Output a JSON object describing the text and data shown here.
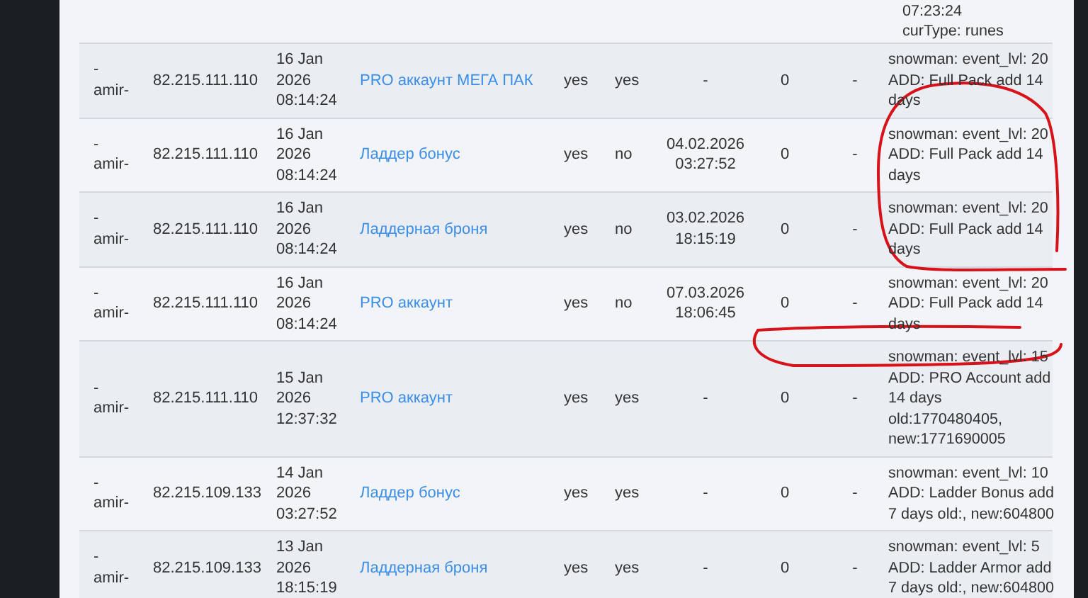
{
  "partial_row": {
    "notes": [
      "07:23:24",
      "curType: runes"
    ]
  },
  "rows": [
    {
      "user": [
        "-",
        "amir-"
      ],
      "ip": "82.215.111.110",
      "date": "16 Jan 2026 08:14:24",
      "item": "PRO аккаунт МЕГА ПАК",
      "column_5": "yes",
      "column_6": "yes",
      "column_7": "-",
      "column_8": "0",
      "column_9": "-",
      "notes": [
        "snowman: event_lvl: 20",
        "ADD: Full Pack add 14",
        "days"
      ]
    },
    {
      "user": [
        "-",
        "amir-"
      ],
      "ip": "82.215.111.110",
      "date": "16 Jan 2026 08:14:24",
      "item": "Ладдер бонус",
      "column_5": "yes",
      "column_6": "no",
      "column_7": "04.02.2026 03:27:52",
      "column_8": "0",
      "column_9": "-",
      "notes": [
        "snowman: event_lvl: 20",
        "ADD: Full Pack add 14",
        "days"
      ]
    },
    {
      "user": [
        "-",
        "amir-"
      ],
      "ip": "82.215.111.110",
      "date": "16 Jan 2026 08:14:24",
      "item": "Ладдерная броня",
      "column_5": "yes",
      "column_6": "no",
      "column_7": "03.02.2026 18:15:19",
      "column_8": "0",
      "column_9": "-",
      "notes": [
        "snowman: event_lvl: 20",
        "ADD: Full Pack add 14",
        "days"
      ]
    },
    {
      "user": [
        "-",
        "amir-"
      ],
      "ip": "82.215.111.110",
      "date": "16 Jan 2026 08:14:24",
      "item": "PRO аккаунт",
      "column_5": "yes",
      "column_6": "no",
      "column_7": "07.03.2026 18:06:45",
      "column_8": "0",
      "column_9": "-",
      "notes": [
        "snowman: event_lvl: 20",
        "ADD: Full Pack add 14",
        "days"
      ]
    },
    {
      "user": [
        "-",
        "amir-"
      ],
      "ip": "82.215.111.110",
      "date": "15 Jan 2026 12:37:32",
      "item": "PRO аккаунт",
      "column_5": "yes",
      "column_6": "yes",
      "column_7": "-",
      "column_8": "0",
      "column_9": "-",
      "notes": [
        "snowman: event_lvl: 15",
        "ADD: PRO Account add",
        "14 days",
        "old:1770480405,",
        "new:1771690005"
      ]
    },
    {
      "user": [
        "-",
        "amir-"
      ],
      "ip": "82.215.109.133",
      "date": "14 Jan 2026 03:27:52",
      "item": "Ладдер бонус",
      "column_5": "yes",
      "column_6": "yes",
      "column_7": "-",
      "column_8": "0",
      "column_9": "-",
      "notes": [
        "snowman: event_lvl: 10",
        "ADD: Ladder Bonus add",
        "7 days old:, new:604800"
      ]
    },
    {
      "user": [
        "-",
        "amir-"
      ],
      "ip": "82.215.109.133",
      "date": "13 Jan 2026 18:15:19",
      "item": "Ладдерная броня",
      "column_5": "yes",
      "column_6": "yes",
      "column_7": "-",
      "column_8": "0",
      "column_9": "-",
      "notes": [
        "snowman: event_lvl: 5",
        "ADD: Ladder Armor add",
        "7 days old:, new:604800"
      ]
    }
  ]
}
